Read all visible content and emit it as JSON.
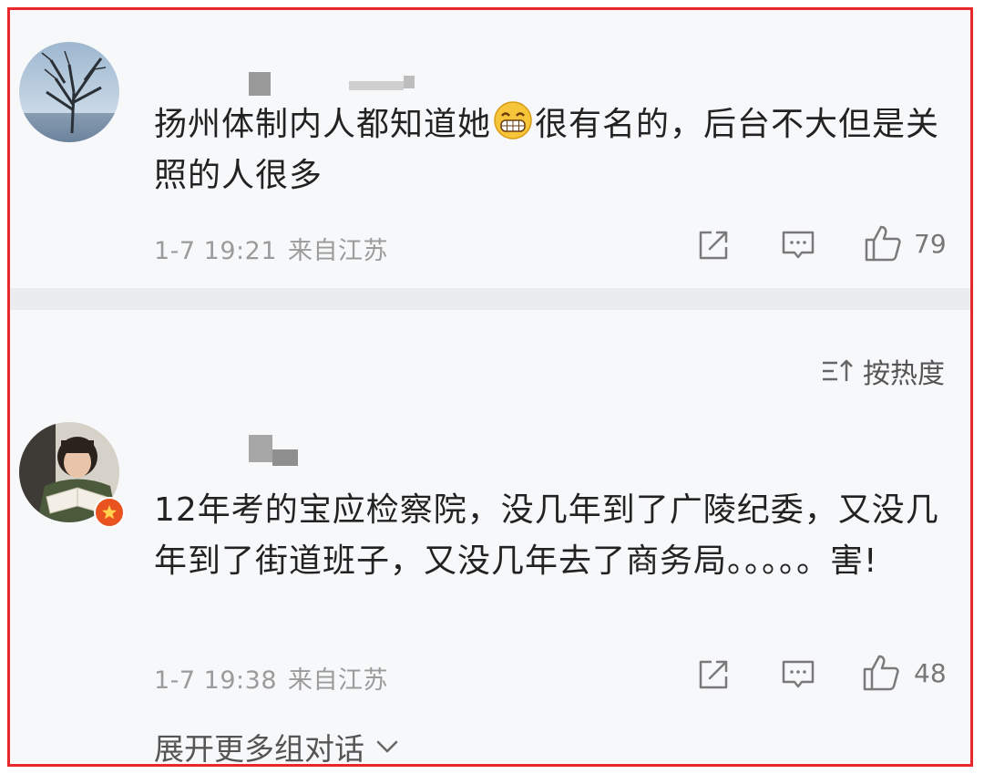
{
  "comments": [
    {
      "text": "扬州体制内人都知道她",
      "emoji": "grin-emoji",
      "text_after": "很有名的，后台不大但是关照的人很多",
      "date": "1-7 19:21",
      "location": "来自江苏",
      "likes": "79"
    },
    {
      "text": "12年考的宝应检察院，没几年到了广陵纪委，又没几年到了街道班子，又没几年去了商务局。。。。。害!",
      "date": "1-7 19:38",
      "location": "来自江苏",
      "likes": "48"
    }
  ],
  "sort": {
    "label": "按热度",
    "icon": "sort-icon"
  },
  "expand": {
    "label": "展开更多组对话",
    "icon": "chevron-down-icon"
  },
  "colors": {
    "highlight_border": "#e8282b",
    "background": "#f7f8fa",
    "meta_text": "#9b9b9b"
  }
}
